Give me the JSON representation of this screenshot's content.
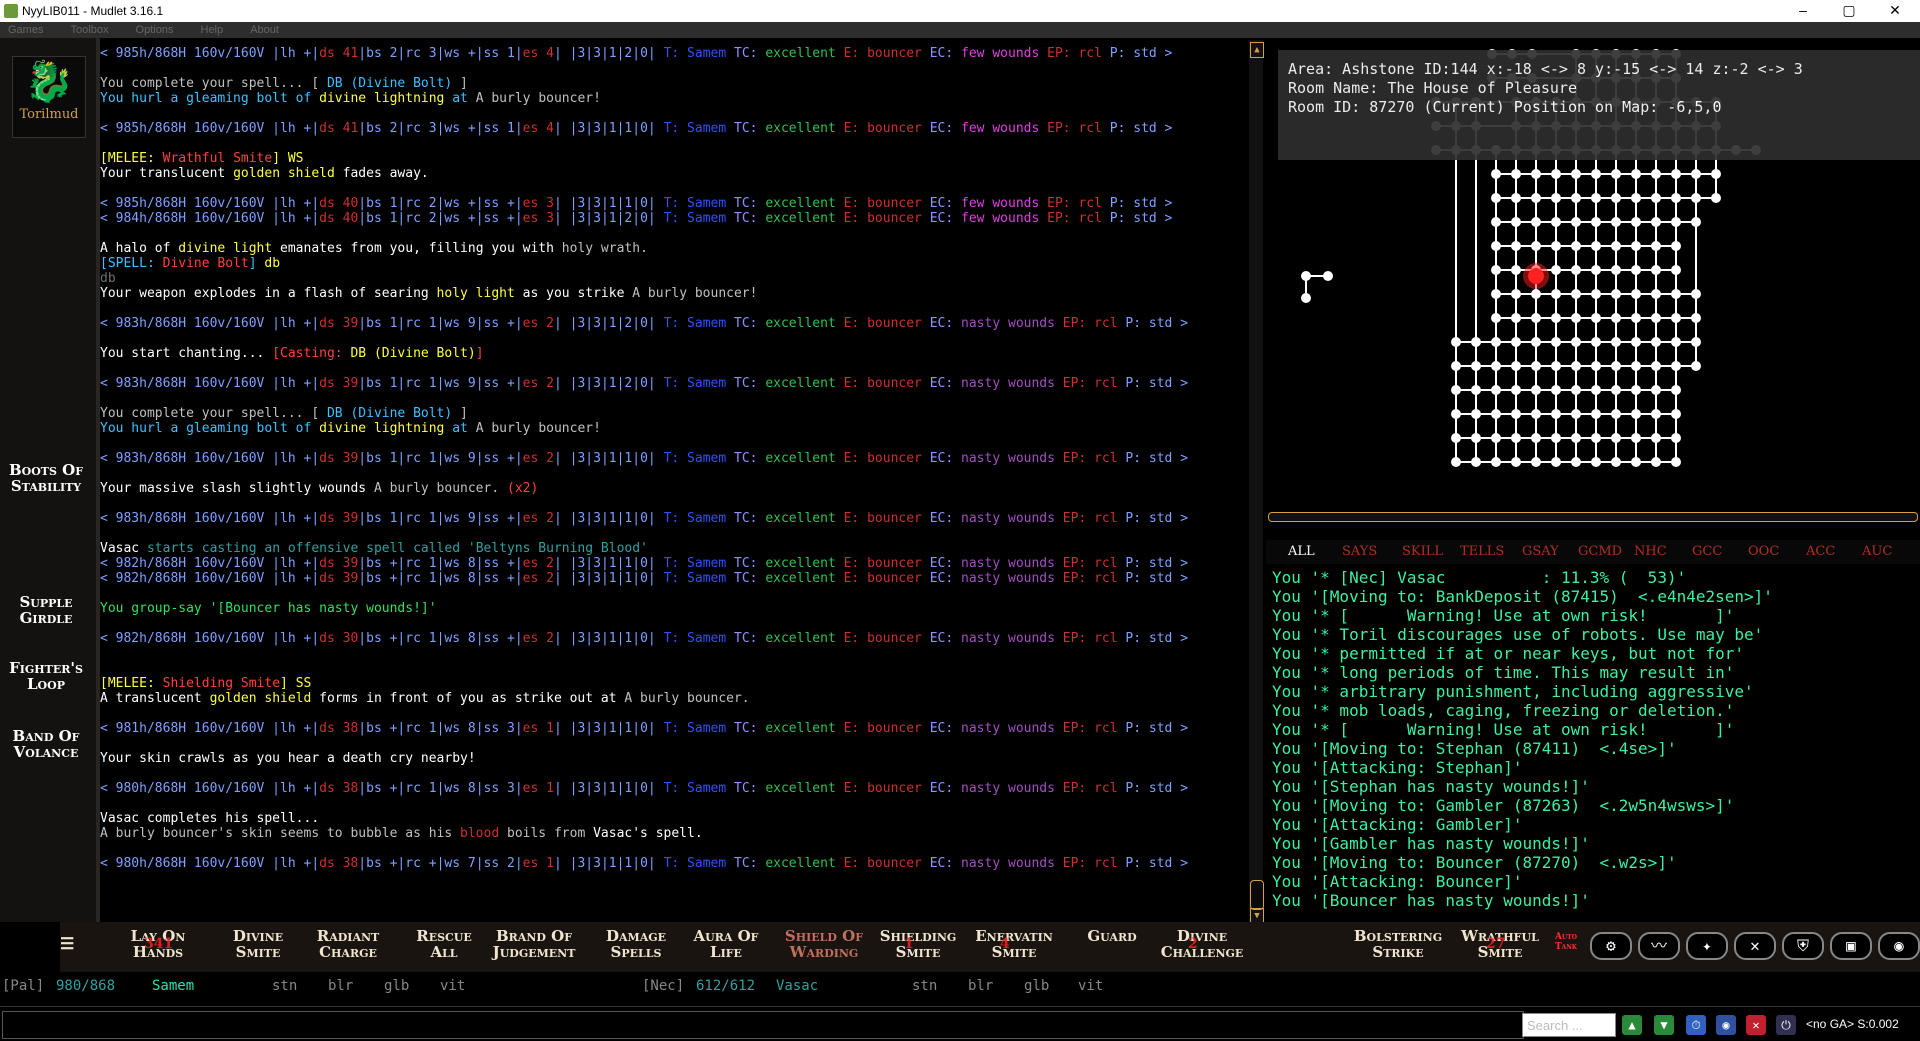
{
  "window": {
    "title": "NyyLIB011 - Mudlet 3.16.1",
    "minimize": "–",
    "maximize": "▢",
    "close": "✕"
  },
  "menu": [
    "Games",
    "Toolbox",
    "Options",
    "Help",
    "About"
  ],
  "leftbar": {
    "logo_text": "Torilmud",
    "logo_icon": "dragon-icon",
    "items": [
      "Boots Of Stability",
      "Supple Girdle",
      "Fighter's Loop",
      "Band Of Volance"
    ]
  },
  "output": [
    [
      [
        "< 985h/868H 160v/160V |lh +|",
        "#7fa0ff"
      ],
      [
        "ds 41",
        "#cc3030"
      ],
      [
        "|bs 2|rc 3|ws +|ss 1|",
        "#7fa0ff"
      ],
      [
        "es 4",
        "#cc3030"
      ],
      [
        "| |3|3|1|2|0| ",
        "#7fa0ff"
      ],
      [
        "T: Samem",
        "#3050ff"
      ],
      [
        " TC: ",
        "#9090ff"
      ],
      [
        "excellent",
        "#30c050"
      ],
      [
        " E: ",
        "#cc3030"
      ],
      [
        "bouncer",
        "#cc3030"
      ],
      [
        " EC: ",
        "#9090ff"
      ],
      [
        "few wounds",
        "#e040e0"
      ],
      [
        " EP: rcl ",
        "#cc3030"
      ],
      [
        "P: std >",
        "#7fa0ff"
      ]
    ],
    [],
    [
      [
        "You complete your spell... ",
        "#c0c0c0"
      ],
      [
        "[ ",
        "#c0c0c0"
      ],
      [
        "DB (Divine Bolt)",
        "#40c0ff"
      ],
      [
        " ]",
        "#c0c0c0"
      ]
    ],
    [
      [
        "You hurl a gleaming bolt of ",
        "#40c0ff"
      ],
      [
        "divine lightning",
        "#ffff40"
      ],
      [
        " at ",
        "#40c0ff"
      ],
      [
        "A burly bouncer!",
        "#c0c0c0"
      ]
    ],
    [],
    [
      [
        "< 985h/868H 160v/160V |lh +|",
        "#7fa0ff"
      ],
      [
        "ds 41",
        "#cc3030"
      ],
      [
        "|bs 2|rc 3|ws +|ss 1|",
        "#7fa0ff"
      ],
      [
        "es 4",
        "#cc3030"
      ],
      [
        "| |3|3|1|1|0| ",
        "#7fa0ff"
      ],
      [
        "T: Samem",
        "#3050ff"
      ],
      [
        " TC: ",
        "#9090ff"
      ],
      [
        "excellent",
        "#30c050"
      ],
      [
        " E: ",
        "#cc3030"
      ],
      [
        "bouncer",
        "#cc3030"
      ],
      [
        " EC: ",
        "#9090ff"
      ],
      [
        "few wounds",
        "#e040e0"
      ],
      [
        " EP: rcl ",
        "#cc3030"
      ],
      [
        "P: std >",
        "#7fa0ff"
      ]
    ],
    [],
    [
      [
        "[MELEE: ",
        "#ffff40"
      ],
      [
        "Wrathful Smite",
        "#ff4040"
      ],
      [
        "] ",
        "#ffff40"
      ],
      [
        "WS",
        "#ffff40"
      ]
    ],
    [
      [
        "Your translucent ",
        "#ffffff"
      ],
      [
        "golden shield",
        "#ffff40"
      ],
      [
        " fades away.",
        "#ffffff"
      ]
    ],
    [],
    [
      [
        "< 985h/868H 160v/160V |lh +|",
        "#7fa0ff"
      ],
      [
        "ds 40",
        "#cc3030"
      ],
      [
        "|bs 1|rc 2|ws +|ss +|",
        "#7fa0ff"
      ],
      [
        "es 3",
        "#cc3030"
      ],
      [
        "| |3|3|1|1|0| ",
        "#7fa0ff"
      ],
      [
        "T: Samem",
        "#3050ff"
      ],
      [
        " TC: ",
        "#9090ff"
      ],
      [
        "excellent",
        "#30c050"
      ],
      [
        " E: ",
        "#cc3030"
      ],
      [
        "bouncer",
        "#cc3030"
      ],
      [
        " EC: ",
        "#9090ff"
      ],
      [
        "few wounds",
        "#e040e0"
      ],
      [
        " EP: rcl ",
        "#cc3030"
      ],
      [
        "P: std >",
        "#7fa0ff"
      ]
    ],
    [
      [
        "< 984h/868H 160v/160V |lh +|",
        "#7fa0ff"
      ],
      [
        "ds 40",
        "#cc3030"
      ],
      [
        "|bs 1|rc 2|ws +|ss +|",
        "#7fa0ff"
      ],
      [
        "es 3",
        "#cc3030"
      ],
      [
        "| |3|3|1|2|0| ",
        "#7fa0ff"
      ],
      [
        "T: Samem",
        "#3050ff"
      ],
      [
        " TC: ",
        "#9090ff"
      ],
      [
        "excellent",
        "#30c050"
      ],
      [
        " E: ",
        "#cc3030"
      ],
      [
        "bouncer",
        "#cc3030"
      ],
      [
        " EC: ",
        "#9090ff"
      ],
      [
        "few wounds",
        "#e040e0"
      ],
      [
        " EP: rcl ",
        "#cc3030"
      ],
      [
        "P: std >",
        "#7fa0ff"
      ]
    ],
    [],
    [
      [
        "A halo of ",
        "#ffffff"
      ],
      [
        "divine light",
        "#ffff40"
      ],
      [
        " emanates from you, filling you with ",
        "#ffffff"
      ],
      [
        "holy wrath.",
        "#c0c0c0"
      ]
    ],
    [
      [
        "[SPELL: ",
        "#40c0ff"
      ],
      [
        "Divine Bolt",
        "#ff4040"
      ],
      [
        "] ",
        "#40c0ff"
      ],
      [
        "db",
        "#ffff40"
      ]
    ],
    [
      [
        "db",
        "#707070"
      ]
    ],
    [
      [
        "Your weapon explodes in a flash of searing ",
        "#ffffff"
      ],
      [
        "holy light",
        "#ffff40"
      ],
      [
        " as you strike ",
        "#ffffff"
      ],
      [
        "A burly bouncer!",
        "#c0c0c0"
      ]
    ],
    [],
    [
      [
        "< 983h/868H 160v/160V |lh +|",
        "#7fa0ff"
      ],
      [
        "ds 39",
        "#cc3030"
      ],
      [
        "|bs 1|rc 1|ws 9|ss +|",
        "#7fa0ff"
      ],
      [
        "es 2",
        "#cc3030"
      ],
      [
        "| |3|3|1|2|0| ",
        "#7fa0ff"
      ],
      [
        "T: Samem",
        "#3050ff"
      ],
      [
        " TC: ",
        "#9090ff"
      ],
      [
        "excellent",
        "#30c050"
      ],
      [
        " E: ",
        "#cc3030"
      ],
      [
        "bouncer",
        "#cc3030"
      ],
      [
        " EC: ",
        "#9090ff"
      ],
      [
        "nasty wounds",
        "#a050c0"
      ],
      [
        " EP: rcl ",
        "#cc3030"
      ],
      [
        "P: std >",
        "#7fa0ff"
      ]
    ],
    [],
    [
      [
        "You start chanting... ",
        "#ffffff"
      ],
      [
        "[Casting: ",
        "#ff4040"
      ],
      [
        "DB (Divine Bolt)",
        "#ffff40"
      ],
      [
        "]",
        "#ff4040"
      ]
    ],
    [],
    [
      [
        "< 983h/868H 160v/160V |lh +|",
        "#7fa0ff"
      ],
      [
        "ds 39",
        "#cc3030"
      ],
      [
        "|bs 1|rc 1|ws 9|ss +|",
        "#7fa0ff"
      ],
      [
        "es 2",
        "#cc3030"
      ],
      [
        "| |3|3|1|2|0| ",
        "#7fa0ff"
      ],
      [
        "T: Samem",
        "#3050ff"
      ],
      [
        " TC: ",
        "#9090ff"
      ],
      [
        "excellent",
        "#30c050"
      ],
      [
        " E: ",
        "#cc3030"
      ],
      [
        "bouncer",
        "#cc3030"
      ],
      [
        " EC: ",
        "#9090ff"
      ],
      [
        "nasty wounds",
        "#a050c0"
      ],
      [
        " EP: rcl ",
        "#cc3030"
      ],
      [
        "P: std >",
        "#7fa0ff"
      ]
    ],
    [],
    [
      [
        "You complete your spell... ",
        "#c0c0c0"
      ],
      [
        "[ ",
        "#c0c0c0"
      ],
      [
        "DB (Divine Bolt)",
        "#40c0ff"
      ],
      [
        " ]",
        "#c0c0c0"
      ]
    ],
    [
      [
        "You hurl a gleaming bolt of ",
        "#40c0ff"
      ],
      [
        "divine lightning",
        "#ffff40"
      ],
      [
        " at ",
        "#40c0ff"
      ],
      [
        "A burly bouncer!",
        "#c0c0c0"
      ]
    ],
    [],
    [
      [
        "< 983h/868H 160v/160V |lh +|",
        "#7fa0ff"
      ],
      [
        "ds 39",
        "#cc3030"
      ],
      [
        "|bs 1|rc 1|ws 9|ss +|",
        "#7fa0ff"
      ],
      [
        "es 2",
        "#cc3030"
      ],
      [
        "| |3|3|1|1|0| ",
        "#7fa0ff"
      ],
      [
        "T: Samem",
        "#3050ff"
      ],
      [
        " TC: ",
        "#9090ff"
      ],
      [
        "excellent",
        "#30c050"
      ],
      [
        " E: ",
        "#cc3030"
      ],
      [
        "bouncer",
        "#cc3030"
      ],
      [
        " EC: ",
        "#9090ff"
      ],
      [
        "nasty wounds",
        "#a050c0"
      ],
      [
        " EP: rcl ",
        "#cc3030"
      ],
      [
        "P: std >",
        "#7fa0ff"
      ]
    ],
    [],
    [
      [
        "Your massive slash slightly wounds ",
        "#ffffff"
      ],
      [
        "A burly bouncer.",
        "#c0c0c0"
      ],
      [
        " (x2)",
        "#ff4040"
      ]
    ],
    [],
    [
      [
        "< 983h/868H 160v/160V |lh +|",
        "#7fa0ff"
      ],
      [
        "ds 39",
        "#cc3030"
      ],
      [
        "|bs 1|rc 1|ws 9|ss +|",
        "#7fa0ff"
      ],
      [
        "es 2",
        "#cc3030"
      ],
      [
        "| |3|3|1|1|0| ",
        "#7fa0ff"
      ],
      [
        "T: Samem",
        "#3050ff"
      ],
      [
        " TC: ",
        "#9090ff"
      ],
      [
        "excellent",
        "#30c050"
      ],
      [
        " E: ",
        "#cc3030"
      ],
      [
        "bouncer",
        "#cc3030"
      ],
      [
        " EC: ",
        "#9090ff"
      ],
      [
        "nasty wounds",
        "#a050c0"
      ],
      [
        " EP: rcl ",
        "#cc3030"
      ],
      [
        "P: std >",
        "#7fa0ff"
      ]
    ],
    [],
    [
      [
        "Vasac ",
        "#ffffff"
      ],
      [
        "starts casting an offensive spell called 'Beltyns Burning Blood'",
        "#30a0a0"
      ]
    ],
    [
      [
        "< 982h/868H 160v/160V |lh +|",
        "#7fa0ff"
      ],
      [
        "ds 39",
        "#cc3030"
      ],
      [
        "|bs +|rc 1|ws 8|ss +|",
        "#7fa0ff"
      ],
      [
        "es 2",
        "#cc3030"
      ],
      [
        "| |3|3|1|1|0| ",
        "#7fa0ff"
      ],
      [
        "T: Samem",
        "#3050ff"
      ],
      [
        " TC: ",
        "#9090ff"
      ],
      [
        "excellent",
        "#30c050"
      ],
      [
        " E: ",
        "#cc3030"
      ],
      [
        "bouncer",
        "#cc3030"
      ],
      [
        " EC: ",
        "#9090ff"
      ],
      [
        "nasty wounds",
        "#a050c0"
      ],
      [
        " EP: rcl ",
        "#cc3030"
      ],
      [
        "P: std >",
        "#7fa0ff"
      ]
    ],
    [
      [
        "< 982h/868H 160v/160V |lh +|",
        "#7fa0ff"
      ],
      [
        "ds 39",
        "#cc3030"
      ],
      [
        "|bs +|rc 1|ws 8|ss +|",
        "#7fa0ff"
      ],
      [
        "es 2",
        "#cc3030"
      ],
      [
        "| |3|3|1|1|0| ",
        "#7fa0ff"
      ],
      [
        "T: Samem",
        "#3050ff"
      ],
      [
        " TC: ",
        "#9090ff"
      ],
      [
        "excellent",
        "#30c050"
      ],
      [
        " E: ",
        "#cc3030"
      ],
      [
        "bouncer",
        "#cc3030"
      ],
      [
        " EC: ",
        "#9090ff"
      ],
      [
        "nasty wounds",
        "#a050c0"
      ],
      [
        " EP: rcl ",
        "#cc3030"
      ],
      [
        "P: std >",
        "#7fa0ff"
      ]
    ],
    [],
    [
      [
        "You group-say '",
        "#30e060"
      ],
      [
        "[Bouncer has nasty wounds!]'",
        "#30e060"
      ]
    ],
    [],
    [
      [
        "< 982h/868H 160v/160V |lh +|",
        "#7fa0ff"
      ],
      [
        "ds 30",
        "#cc3030"
      ],
      [
        "|bs +|rc 1|ws 8|ss +|",
        "#7fa0ff"
      ],
      [
        "es 2",
        "#cc3030"
      ],
      [
        "| |3|3|1|1|0| ",
        "#7fa0ff"
      ],
      [
        "T: Samem",
        "#3050ff"
      ],
      [
        " TC: ",
        "#9090ff"
      ],
      [
        "excellent",
        "#30c050"
      ],
      [
        " E: ",
        "#cc3030"
      ],
      [
        "bouncer",
        "#cc3030"
      ],
      [
        " EC: ",
        "#9090ff"
      ],
      [
        "nasty wounds",
        "#a050c0"
      ],
      [
        " EP: rcl ",
        "#cc3030"
      ],
      [
        "P: std >",
        "#7fa0ff"
      ]
    ],
    [],
    [],
    [
      [
        "[MELEE: ",
        "#ffff40"
      ],
      [
        "Shielding Smite",
        "#ff4040"
      ],
      [
        "] ",
        "#ffff40"
      ],
      [
        "SS",
        "#ffff40"
      ]
    ],
    [
      [
        "A translucent ",
        "#ffffff"
      ],
      [
        "golden shield",
        "#ffff40"
      ],
      [
        " forms in front of you as strike out at ",
        "#ffffff"
      ],
      [
        "A burly bouncer.",
        "#c0c0c0"
      ]
    ],
    [],
    [
      [
        "< 981h/868H 160v/160V |lh +|",
        "#7fa0ff"
      ],
      [
        "ds 38",
        "#cc3030"
      ],
      [
        "|bs +|rc 1|ws 8|ss 3|",
        "#7fa0ff"
      ],
      [
        "es 1",
        "#cc3030"
      ],
      [
        "| |3|3|1|1|0| ",
        "#7fa0ff"
      ],
      [
        "T: Samem",
        "#3050ff"
      ],
      [
        " TC: ",
        "#9090ff"
      ],
      [
        "excellent",
        "#30c050"
      ],
      [
        " E: ",
        "#cc3030"
      ],
      [
        "bouncer",
        "#cc3030"
      ],
      [
        " EC: ",
        "#9090ff"
      ],
      [
        "nasty wounds",
        "#a050c0"
      ],
      [
        " EP: rcl ",
        "#cc3030"
      ],
      [
        "P: std >",
        "#7fa0ff"
      ]
    ],
    [],
    [
      [
        "Your skin crawls as you hear a death cry nearby!",
        "#ffffff"
      ]
    ],
    [],
    [
      [
        "< 980h/868H 160v/160V |lh +|",
        "#7fa0ff"
      ],
      [
        "ds 38",
        "#cc3030"
      ],
      [
        "|bs +|rc 1|ws 8|ss 3|",
        "#7fa0ff"
      ],
      [
        "es 1",
        "#cc3030"
      ],
      [
        "| |3|3|1|1|0| ",
        "#7fa0ff"
      ],
      [
        "T: Samem",
        "#3050ff"
      ],
      [
        " TC: ",
        "#9090ff"
      ],
      [
        "excellent",
        "#30c050"
      ],
      [
        " E: ",
        "#cc3030"
      ],
      [
        "bouncer",
        "#cc3030"
      ],
      [
        " EC: ",
        "#9090ff"
      ],
      [
        "nasty wounds",
        "#a050c0"
      ],
      [
        " EP: rcl ",
        "#cc3030"
      ],
      [
        "P: std >",
        "#7fa0ff"
      ]
    ],
    [],
    [
      [
        "Vasac completes his spell...",
        "#ffffff"
      ]
    ],
    [
      [
        "A burly bouncer's skin seems to bubble as his ",
        "#c0c0c0"
      ],
      [
        "blood",
        "#cc3030"
      ],
      [
        " boils from ",
        "#c0c0c0"
      ],
      [
        "Vasac's spell.",
        "#ffffff"
      ]
    ],
    [],
    [
      [
        "< 980h/868H 160v/160V |lh +|",
        "#7fa0ff"
      ],
      [
        "ds 38",
        "#cc3030"
      ],
      [
        "|bs +|rc +|ws 7|ss 2|",
        "#7fa0ff"
      ],
      [
        "es 1",
        "#cc3030"
      ],
      [
        "| |3|3|1|1|0| ",
        "#7fa0ff"
      ],
      [
        "T: Samem",
        "#3050ff"
      ],
      [
        " TC: ",
        "#9090ff"
      ],
      [
        "excellent",
        "#30c050"
      ],
      [
        " E: ",
        "#cc3030"
      ],
      [
        "bouncer",
        "#cc3030"
      ],
      [
        " EC: ",
        "#9090ff"
      ],
      [
        "nasty wounds",
        "#a050c0"
      ],
      [
        " EP: rcl ",
        "#cc3030"
      ],
      [
        "P: std >",
        "#7fa0ff"
      ]
    ]
  ],
  "map": {
    "area_line": "Area: Ashstone ID:144 x:-18 <-> 8 y:-15 <-> 14 z:-2 <-> 3",
    "room_name": "Room Name: The House of Pleasure",
    "room_id": "Room ID: 87270 (Current) Position on Map: -6,5,0",
    "player_color": "#ff2020"
  },
  "chat": {
    "tabs": [
      "ALL",
      "SAYS",
      "SKILL",
      "TELLS",
      "GSAY",
      "GCMD",
      "NHC",
      "GCC",
      "OOC",
      "ACC",
      "AUC"
    ],
    "lines": [
      "You '* [Nec] Vasac          : 11.3% (  53)'",
      "You '[Moving to: BankDeposit (87415)  <.e4n4e2sen>]'",
      "You '* [      Warning! Use at own risk!       ]'",
      "You '* Toril discourages use of robots. Use may be'",
      "You '* permitted if at or near keys, but not for'",
      "You '* long periods of time. This may result in'",
      "You '* arbitrary punishment, including aggressive'",
      "You '* mob loads, caging, freezing or deletion.'",
      "You '* [      Warning! Use at own risk!       ]'",
      "You '[Moving to: Stephan (87411)  <.4se>]'",
      "You '[Attacking: Stephan]'",
      "You '[Stephan has nasty wounds!]'",
      "You '[Moving to: Gambler (87263)  <.2w5n4wsws>]'",
      "You '[Attacking: Gambler]'",
      "You '[Gambler has nasty wounds!]'",
      "You '[Moving to: Bouncer (87270)  <.w2s>]'",
      "You '[Attacking: Bouncer]'",
      "You '[Bouncer has nasty wounds!]'"
    ]
  },
  "buttons": {
    "menu_glyph": "☰",
    "labels": [
      [
        "Lay On",
        "Hands"
      ],
      [
        "Divine",
        "Smite"
      ],
      [
        "Radiant",
        "Charge"
      ],
      [
        "Rescue",
        "All"
      ],
      [
        "Brand Of",
        "Judgement"
      ],
      [
        "Damage",
        "Spells"
      ],
      [
        "Aura Of",
        "Life"
      ],
      [
        "Shield Of",
        "Warding"
      ],
      [
        "Shielding",
        "Smite"
      ],
      [
        "Enervatin",
        "Smite"
      ],
      [
        "Guard",
        ""
      ],
      [
        "Divine",
        "Challenge"
      ],
      [
        "Bolstering",
        "Strike"
      ],
      [
        "Wrathful",
        "Smite"
      ]
    ],
    "overlay_numbers": [
      "341",
      "",
      "",
      "",
      "",
      "",
      "",
      "",
      "1",
      "4",
      "",
      "2",
      "",
      "27"
    ],
    "auto_tank": "Auto Tank",
    "icons": [
      "gear-icon",
      "heartbeat-icon",
      "wings-icon",
      "swords-icon",
      "shield-icon",
      "bag-icon",
      "eye-icon"
    ]
  },
  "status": {
    "pal_class": "[Pal]",
    "pal_hp": "980/868",
    "pal_name": "Samem",
    "pal_buffs": [
      "stn",
      "blr",
      "glb",
      "vit"
    ],
    "nec_class": "[Nec]",
    "nec_hp": "612/612",
    "nec_name": "Vasac",
    "nec_buffs": [
      "stn",
      "blr",
      "glb",
      "vit"
    ]
  },
  "input": {
    "command": "",
    "search_placeholder": "Search ...",
    "ga_status": "<no GA> S:0.002"
  }
}
